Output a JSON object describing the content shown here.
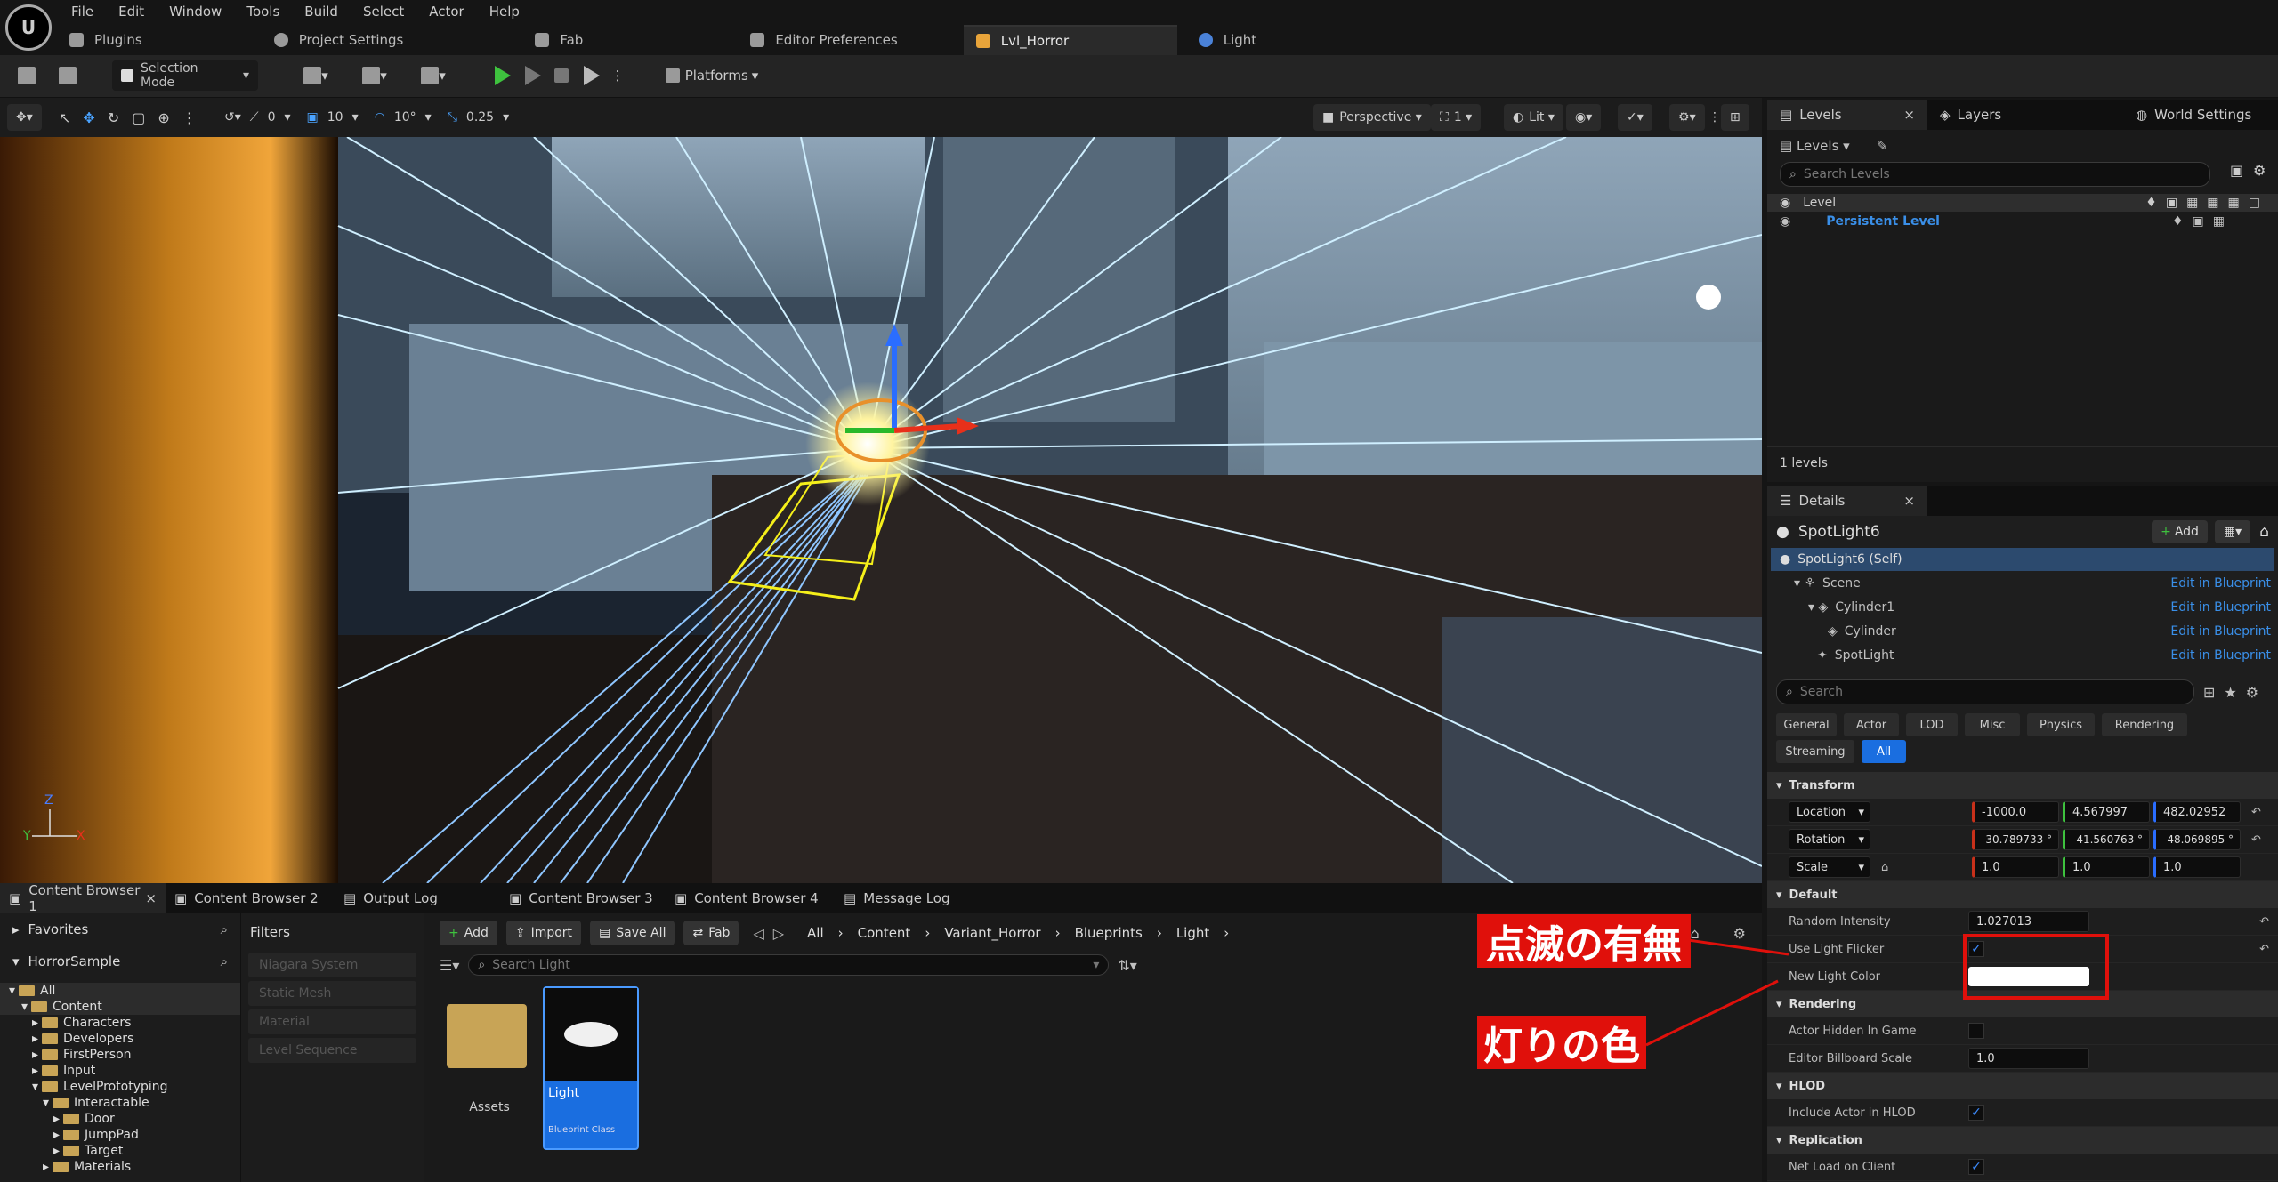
{
  "menu": [
    "File",
    "Edit",
    "Window",
    "Tools",
    "Build",
    "Select",
    "Actor",
    "Help"
  ],
  "tabs": [
    {
      "label": "Plugins",
      "color": "#9a9a9a"
    },
    {
      "label": "Project Settings",
      "color": "#9a9a9a"
    },
    {
      "label": "Fab",
      "color": "#9a9a9a"
    },
    {
      "label": "Editor Preferences",
      "color": "#9a9a9a"
    },
    {
      "label": "Lvl_Horror",
      "color": "#e8a43a"
    },
    {
      "label": "Light",
      "color": "#4a82d8"
    }
  ],
  "toolbar": {
    "selection_mode": "Selection Mode",
    "platforms": "Platforms"
  },
  "viewport_toolbar": {
    "rot_snap": "0",
    "pos_snap": "10",
    "angle_snap": "10°",
    "scale_snap": "0.25",
    "perspective": "Perspective",
    "cam_speed": "1",
    "lit": "Lit"
  },
  "axis_labels": {
    "z": "Z",
    "y": "Y",
    "x": "X"
  },
  "levels_panel": {
    "tabs": [
      "Levels",
      "Layers",
      "World Settings"
    ],
    "dropdown": "Levels",
    "search_placeholder": "Search Levels",
    "header": "Level",
    "persistent": "Persistent Level",
    "count": "1 levels"
  },
  "details": {
    "tab": "Details",
    "actor": "SpotLight6",
    "add": "Add",
    "components": [
      {
        "name": "SpotLight6 (Self)",
        "link": ""
      },
      {
        "name": "Scene",
        "link": "Edit in Blueprint"
      },
      {
        "name": "Cylinder1",
        "link": "Edit in Blueprint"
      },
      {
        "name": "Cylinder",
        "link": "Edit in Blueprint"
      },
      {
        "name": "SpotLight",
        "link": "Edit in Blueprint"
      }
    ],
    "search_placeholder": "Search",
    "filter_tabs": [
      "General",
      "Actor",
      "LOD",
      "Misc",
      "Physics",
      "Rendering",
      "Streaming",
      "All"
    ],
    "sections": {
      "transform": "Transform",
      "default": "Default",
      "rendering": "Rendering",
      "hlod": "HLOD",
      "replication": "Replication"
    },
    "transform": {
      "location_label": "Location",
      "location": [
        "-1000.0",
        "4.567997",
        "482.02952"
      ],
      "rotation_label": "Rotation",
      "rotation": [
        "-30.789733 °",
        "-41.560763 °",
        "-48.069895 °"
      ],
      "scale_label": "Scale",
      "scale": [
        "1.0",
        "1.0",
        "1.0"
      ]
    },
    "default_props": {
      "random_intensity_label": "Random Intensity",
      "random_intensity": "1.027013",
      "use_flicker_label": "Use Light Flicker",
      "new_color_label": "New Light Color"
    },
    "rendering_props": {
      "hidden_label": "Actor Hidden In Game",
      "billboard_label": "Editor Billboard Scale",
      "billboard": "1.0"
    },
    "hlod_props": {
      "include_label": "Include Actor in HLOD"
    },
    "replication_props": {
      "net_load_label": "Net Load on Client"
    }
  },
  "bottom_tabs": [
    "Content Browser 1",
    "Content Browser 2",
    "Output Log",
    "Content Browser 3",
    "Content Browser 4",
    "Message Log"
  ],
  "content_browser": {
    "favorites": "Favorites",
    "project": "HorrorSample",
    "tree": [
      {
        "label": "All",
        "depth": 0
      },
      {
        "label": "Content",
        "depth": 1
      },
      {
        "label": "Characters",
        "depth": 2
      },
      {
        "label": "Developers",
        "depth": 2
      },
      {
        "label": "FirstPerson",
        "depth": 2
      },
      {
        "label": "Input",
        "depth": 2
      },
      {
        "label": "LevelPrototyping",
        "depth": 2
      },
      {
        "label": "Interactable",
        "depth": 3
      },
      {
        "label": "Door",
        "depth": 4
      },
      {
        "label": "JumpPad",
        "depth": 4
      },
      {
        "label": "Target",
        "depth": 4
      },
      {
        "label": "Materials",
        "depth": 3
      }
    ],
    "filters_title": "Filters",
    "filters": [
      "Niagara System",
      "Static Mesh",
      "Material",
      "Level Sequence"
    ],
    "buttons": {
      "add": "Add",
      "import": "Import",
      "save_all": "Save All",
      "fab": "Fab"
    },
    "breadcrumb": [
      "All",
      "Content",
      "Variant_Horror",
      "Blueprints",
      "Light"
    ],
    "search_placeholder": "Search Light",
    "assets": [
      {
        "name": "Assets",
        "type": ""
      },
      {
        "name": "Light",
        "type": "Blueprint Class"
      }
    ]
  },
  "annotations": {
    "flicker": "点滅の有無",
    "color": "灯りの色",
    "accent": "#e0100b"
  }
}
